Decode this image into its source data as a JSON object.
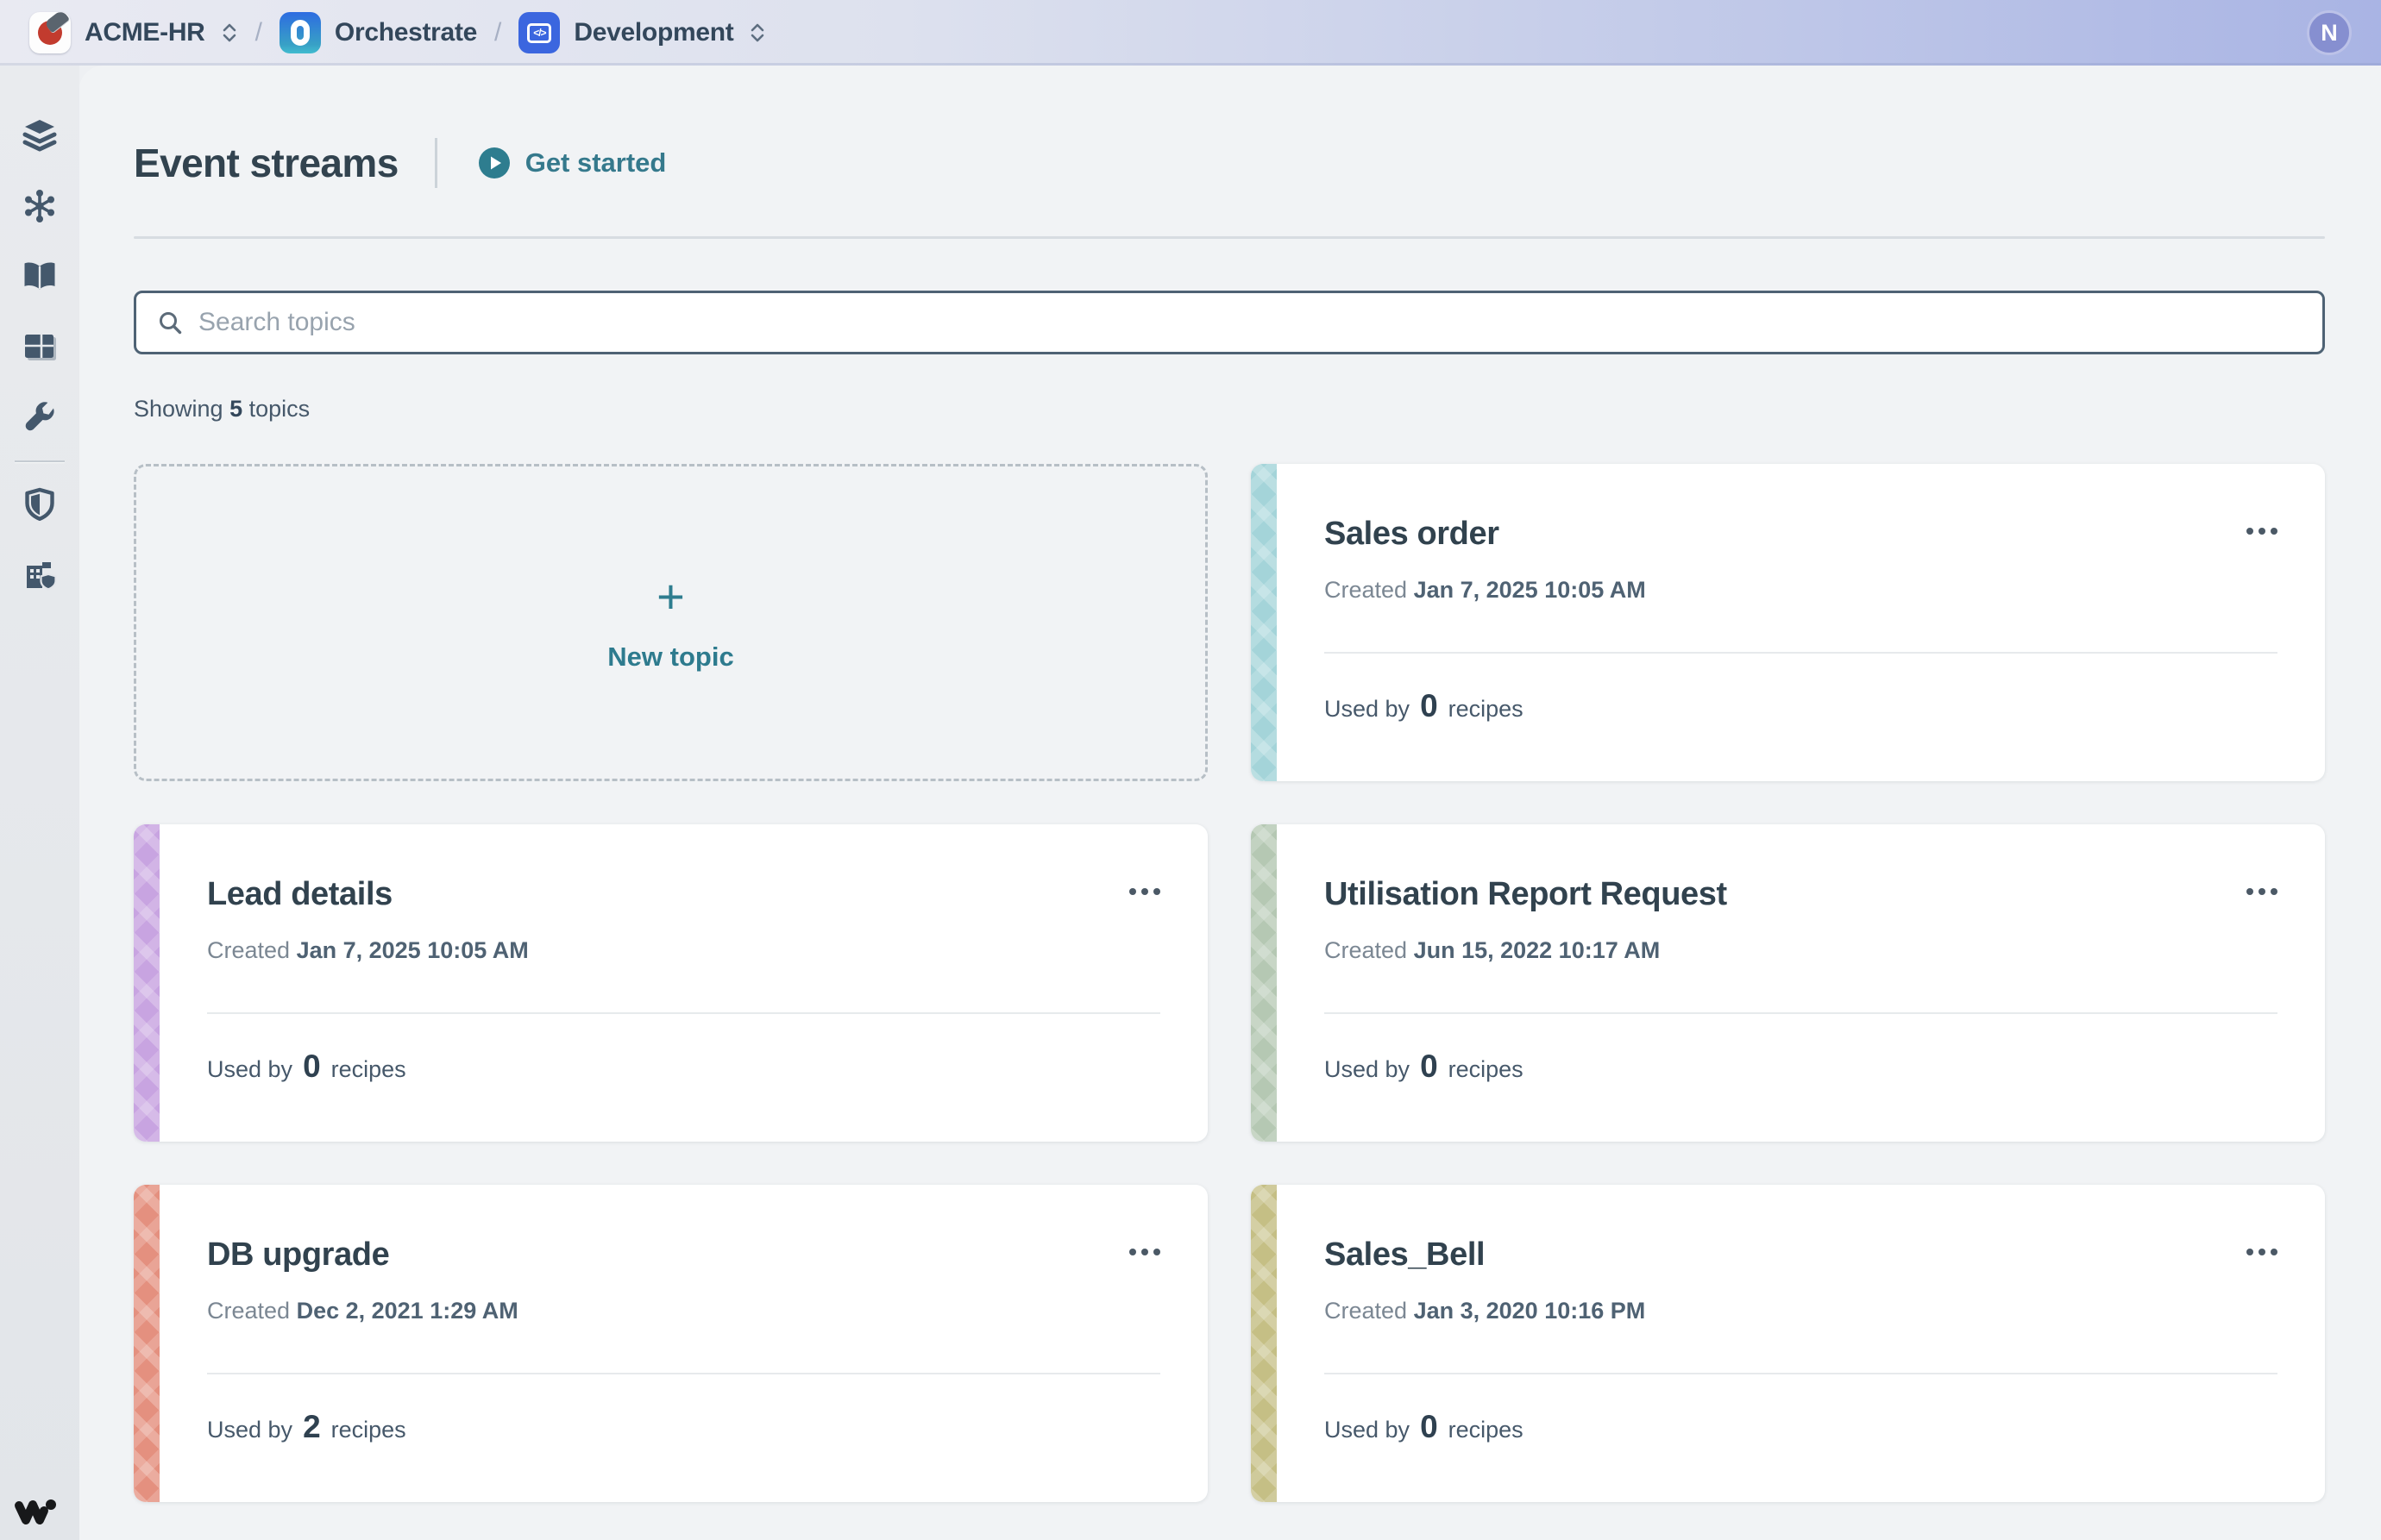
{
  "topbar": {
    "workspace": {
      "label": "ACME-HR"
    },
    "separator": "/",
    "product": {
      "label": "Orchestrate"
    },
    "environment": {
      "label": "Development"
    },
    "avatar_initial": "N"
  },
  "sidebar": {
    "icons": [
      "layers",
      "hub",
      "library",
      "dashboard",
      "tools",
      "shield",
      "governance"
    ]
  },
  "header": {
    "title": "Event streams",
    "get_started": "Get started"
  },
  "search": {
    "placeholder": "Search topics"
  },
  "summary": {
    "prefix": "Showing",
    "count": "5",
    "suffix": "topics"
  },
  "new_topic": {
    "label": "New topic",
    "plus_icon": "+"
  },
  "card_labels": {
    "created": "Created",
    "used_by": "Used by",
    "recipes": "recipes"
  },
  "topics": [
    {
      "name": "Sales order",
      "created": "Jan 7, 2025 10:05 AM",
      "recipes_count": "0",
      "accent": "#a4d4d9"
    },
    {
      "name": "Lead details",
      "created": "Jan 7, 2025 10:05 AM",
      "recipes_count": "0",
      "accent": "#c8a4e1"
    },
    {
      "name": "Utilisation Report Request",
      "created": "Jun 15, 2022 10:17 AM",
      "recipes_count": "0",
      "accent": "#b5c8b3"
    },
    {
      "name": "DB upgrade",
      "created": "Dec 2, 2021 1:29 AM",
      "recipes_count": "2",
      "accent": "#e4907f"
    },
    {
      "name": "Sales_Bell",
      "created": "Jan 3, 2020 10:16 PM",
      "recipes_count": "0",
      "accent": "#c5bf85"
    }
  ],
  "colors": {
    "accent_teal": "#2e7d8f",
    "topbar_gradient_start": "#e9eaf2",
    "topbar_gradient_end": "#a9b4e4",
    "avatar_bg": "#868fd0",
    "title_text": "#32434f"
  }
}
